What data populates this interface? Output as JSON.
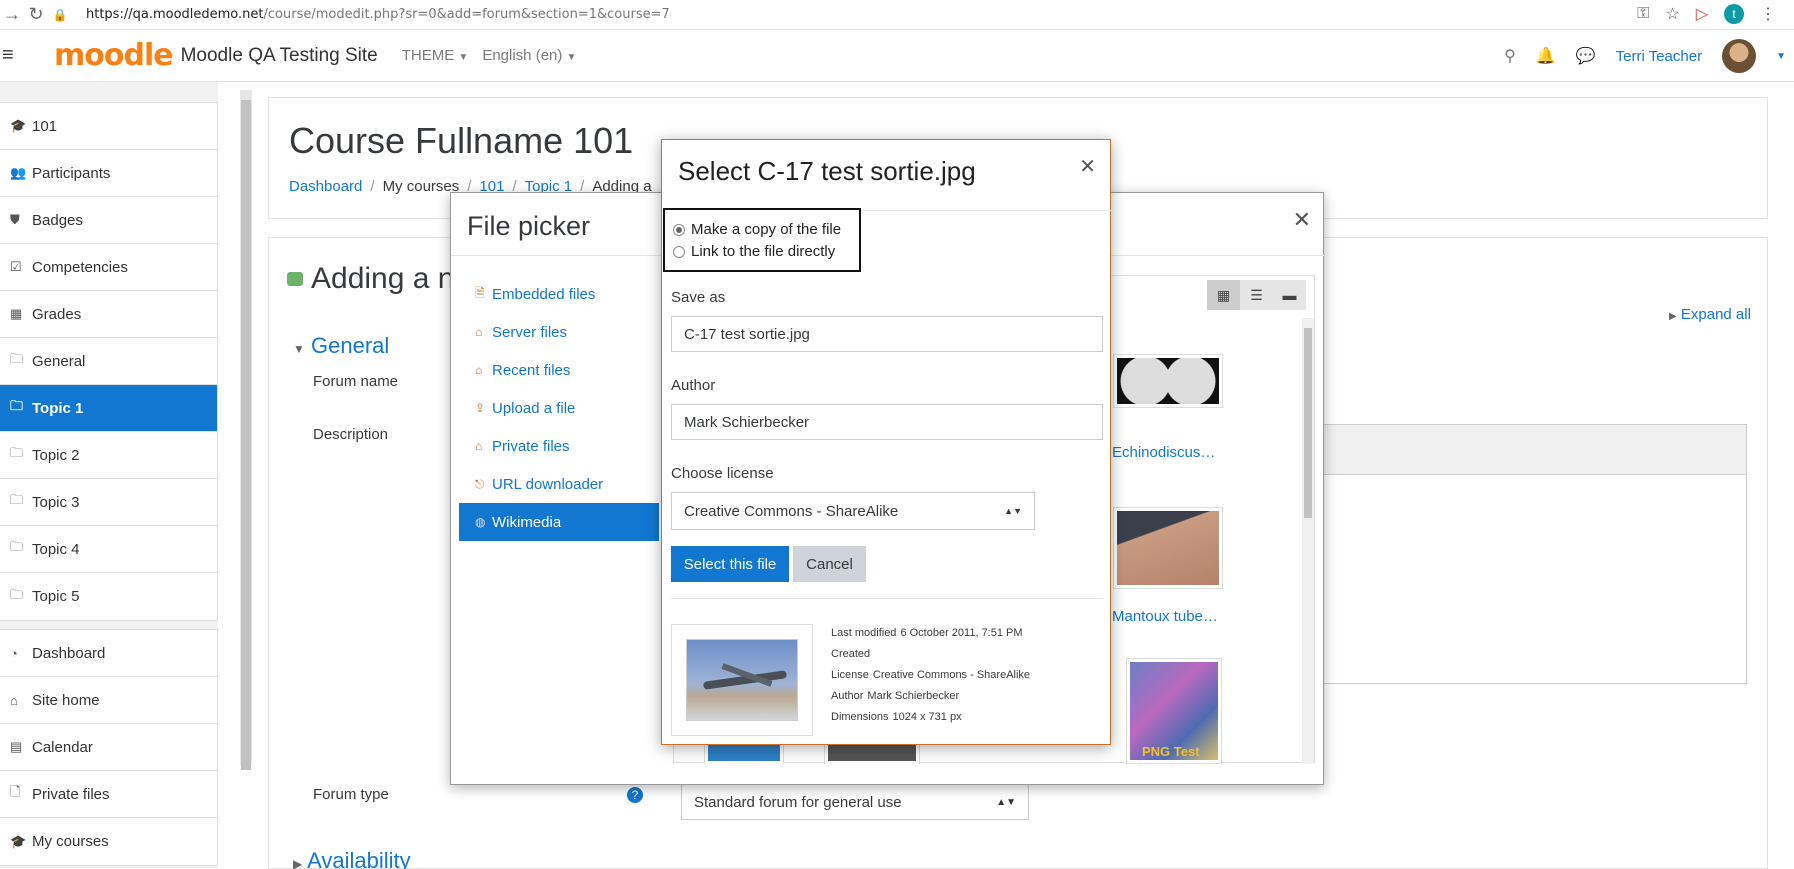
{
  "browser": {
    "url_host": "https://qa.moodledemo.net",
    "url_path": "/course/modedit.php?sr=0&add=forum&section=1&course=7",
    "profile_initial": "t"
  },
  "navbar": {
    "logo": "moodle",
    "site_name": "Moodle QA Testing Site",
    "theme_menu": "THEME",
    "language_menu": "English (en)",
    "user_name": "Terri Teacher"
  },
  "drawer": {
    "course_items": [
      {
        "icon": "graduation-cap-icon",
        "label": "101"
      },
      {
        "icon": "users-icon",
        "label": "Participants"
      },
      {
        "icon": "shield-icon",
        "label": "Badges"
      },
      {
        "icon": "checkbox-icon",
        "label": "Competencies"
      },
      {
        "icon": "table-icon",
        "label": "Grades"
      },
      {
        "icon": "folder-icon",
        "label": "General"
      },
      {
        "icon": "folder-icon",
        "label": "Topic 1",
        "active": true
      },
      {
        "icon": "folder-icon",
        "label": "Topic 2"
      },
      {
        "icon": "folder-icon",
        "label": "Topic 3"
      },
      {
        "icon": "folder-icon",
        "label": "Topic 4"
      },
      {
        "icon": "folder-icon",
        "label": "Topic 5"
      }
    ],
    "site_items": [
      {
        "icon": "dashboard-icon",
        "label": "Dashboard"
      },
      {
        "icon": "home-icon",
        "label": "Site home"
      },
      {
        "icon": "calendar-icon",
        "label": "Calendar"
      },
      {
        "icon": "file-icon",
        "label": "Private files"
      },
      {
        "icon": "graduation-cap-icon",
        "label": "My courses"
      }
    ]
  },
  "header": {
    "title": "Course Fullname 101",
    "breadcrumb": [
      "Dashboard",
      "My courses",
      "101",
      "Topic 1",
      "Adding a"
    ]
  },
  "main": {
    "adding_title": "Adding a n",
    "expand_all": "Expand all",
    "general": "General",
    "forum_name_label": "Forum name",
    "description_label": "Description",
    "forum_type_label": "Forum type",
    "forum_type_value": "Standard forum for general use",
    "availability": "Availability"
  },
  "file_picker": {
    "title": "File picker",
    "repositories": [
      {
        "label": "Embedded files"
      },
      {
        "label": "Server files"
      },
      {
        "label": "Recent files"
      },
      {
        "label": "Upload a file"
      },
      {
        "label": "Private files"
      },
      {
        "label": "URL downloader"
      },
      {
        "label": "Wikimedia",
        "active": true
      }
    ],
    "links": [
      "Echinodiscus…",
      "Mantoux tube…",
      "PNG Test"
    ]
  },
  "select_file": {
    "title": "Select C-17 test sortie.jpg",
    "option_copy": "Make a copy of the file",
    "option_link": "Link to the file directly",
    "save_as_label": "Save as",
    "save_as_value": "C-17 test sortie.jpg",
    "author_label": "Author",
    "author_value": "Mark Schierbecker",
    "license_label": "Choose license",
    "license_value": "Creative Commons - ShareAlike",
    "select_button": "Select this file",
    "cancel_button": "Cancel",
    "meta": {
      "last_modified_key": "Last modified",
      "last_modified_val": "6 October 2011, 7:51 PM",
      "created_key": "Created",
      "license_key": "License",
      "license_val": "Creative Commons - ShareAlike",
      "author_key": "Author",
      "author_val": "Mark Schierbecker",
      "dimensions_key": "Dimensions",
      "dimensions_val": "1024 x 731 px"
    }
  }
}
